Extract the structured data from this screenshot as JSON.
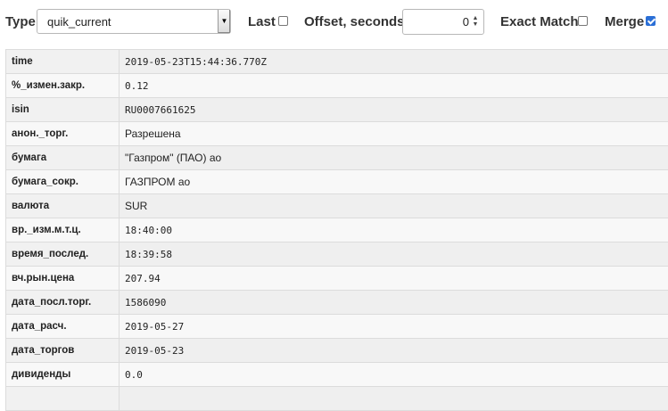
{
  "toolbar": {
    "type_label": "Type",
    "type_value": "quik_current",
    "last_label": "Last",
    "last_checked": false,
    "offset_label": "Offset, seconds",
    "offset_value": "0",
    "exact_label": "Exact Match",
    "exact_checked": false,
    "merge_label": "Merge",
    "merge_checked": true
  },
  "rows": [
    {
      "key": "time",
      "value": "2019-05-23T15:44:36.770Z",
      "mono": true
    },
    {
      "key": "%_измен.закр.",
      "value": "0.12",
      "mono": true
    },
    {
      "key": "isin",
      "value": "RU0007661625",
      "mono": true
    },
    {
      "key": "анон._торг.",
      "value": "Разрешена",
      "mono": false
    },
    {
      "key": "бумага",
      "value": "\"Газпром\" (ПАО) ао",
      "mono": false
    },
    {
      "key": "бумага_сокр.",
      "value": "ГАЗПРОМ ао",
      "mono": false
    },
    {
      "key": "валюта",
      "value": "SUR",
      "mono": false
    },
    {
      "key": "вр._изм.м.т.ц.",
      "value": "18:40:00",
      "mono": true
    },
    {
      "key": "время_послед.",
      "value": "18:39:58",
      "mono": true
    },
    {
      "key": "вч.рын.цена",
      "value": "207.94",
      "mono": true
    },
    {
      "key": "дата_посл.торг.",
      "value": "1586090",
      "mono": true
    },
    {
      "key": "дата_расч.",
      "value": "2019-05-27",
      "mono": true
    },
    {
      "key": "дата_торгов",
      "value": "2019-05-23",
      "mono": true
    },
    {
      "key": "дивиденды",
      "value": "0.0",
      "mono": true
    },
    {
      "key": "",
      "value": "",
      "mono": true
    }
  ]
}
